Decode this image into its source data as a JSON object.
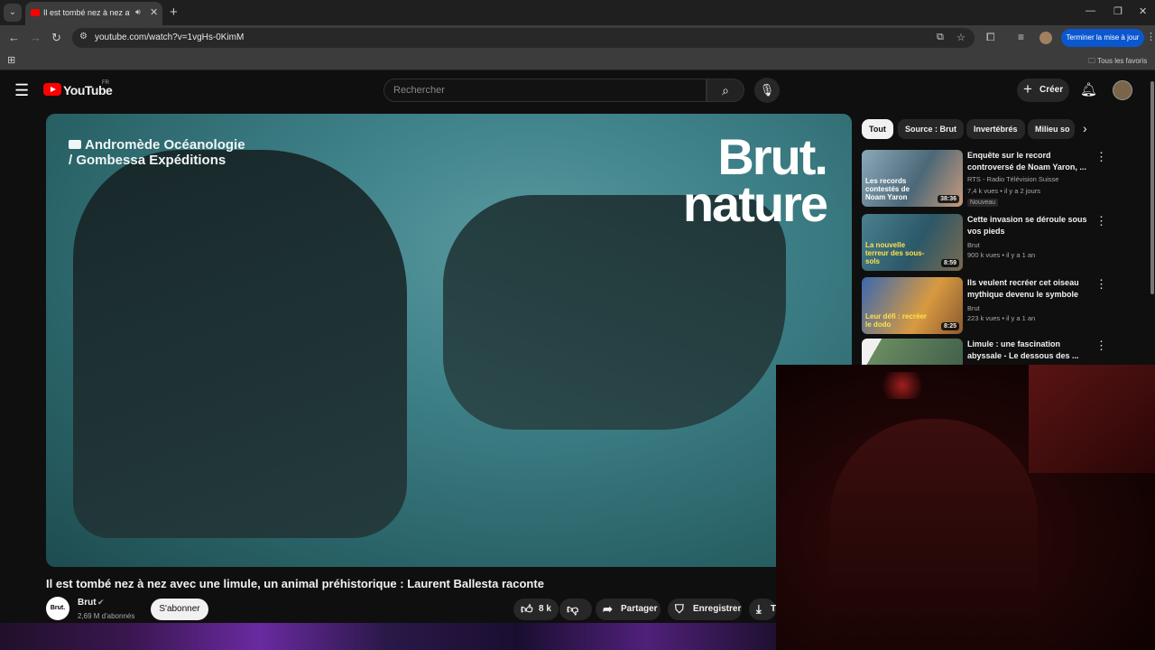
{
  "browser": {
    "tab_title": "Il est tombé nez à nez avec une limule",
    "url": "youtube.com/watch?v=1vgHs-0KimM",
    "update_button": "Terminer la mise à jour",
    "bookmarks_folder": "Tous les favoris"
  },
  "youtube": {
    "logo": "YouTube",
    "country": "FR",
    "search_placeholder": "Rechercher",
    "create_label": "Créer"
  },
  "video": {
    "overlay_credit_line1": "Andromède Océanologie",
    "overlay_credit_line2": "/ Gombessa Expéditions",
    "brand_line1": "Brut.",
    "brand_line2": "nature",
    "title": "Il est tombé nez à nez avec une limule, un animal préhistorique : Laurent Ballesta raconte",
    "channel_avatar_text": "Brut.",
    "channel_name": "Brut",
    "subscribers": "2,69 M d'abonnés",
    "subscribe_label": "S'abonner",
    "likes": "8 k",
    "share_label": "Partager",
    "save_label": "Enregistrer",
    "download_label": "Té"
  },
  "chips": [
    "Tout",
    "Source : Brut",
    "Invertébrés",
    "Milieu so"
  ],
  "recommendations": [
    {
      "title": "Enquête sur le record controversé de Noam Yaron, ...",
      "channel": "RTS - Radio Télévision Suisse",
      "meta": "7,4 k vues • il y a 2 jours",
      "badge": "Nouveau",
      "duration": "38:36",
      "thumb_text": "Les records contestés de Noam Yaron",
      "thumb_color": "#6c8aa0"
    },
    {
      "title": "Cette invasion se déroule sous vos pieds",
      "channel": "Brut",
      "meta": "900 k vues • il y a 1 an",
      "badge": "",
      "duration": "8:59",
      "thumb_text": "La nouvelle terreur des sous-sols",
      "thumb_color": "#3c6a78"
    },
    {
      "title": "Ils veulent recréer cet oiseau mythique devenu le symbole d...",
      "channel": "Brut",
      "meta": "223 k vues • il y a 1 an",
      "badge": "",
      "duration": "8:25",
      "thumb_text": "Leur défi : recréer le dodo",
      "thumb_color": "#c88a3a"
    },
    {
      "title": "Limule : une fascination abyssale - Le dessous des ...",
      "channel": "",
      "meta": "",
      "badge": "",
      "duration": "",
      "thumb_text": "",
      "thumb_color": "#5a7860"
    }
  ],
  "colors": {
    "youtube_red": "#ff0000",
    "update_blue": "#0b57d0",
    "webcam_red": "#3a0a0a"
  }
}
